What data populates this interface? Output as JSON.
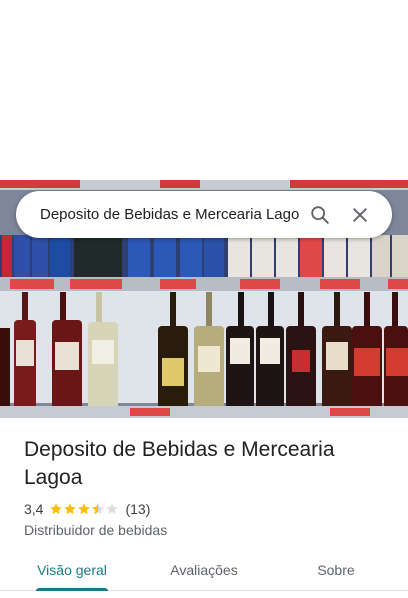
{
  "search": {
    "query": "Deposito de Bebidas e Mercearia Lagoa",
    "search_icon": "search-icon",
    "close_icon": "close-icon"
  },
  "place": {
    "title": "Deposito de Bebidas e Mercearia Lagoa",
    "rating": "3,4",
    "rating_stars": 3.4,
    "review_count": "(13)",
    "category": "Distribuidor de bebidas"
  },
  "tabs": [
    {
      "label": "Visão geral",
      "active": true
    },
    {
      "label": "Avaliações",
      "active": false
    },
    {
      "label": "Sobre",
      "active": false
    }
  ],
  "colors": {
    "accent": "#1a7a8a",
    "star": "#fbbc04",
    "star_empty": "#dadce0"
  }
}
